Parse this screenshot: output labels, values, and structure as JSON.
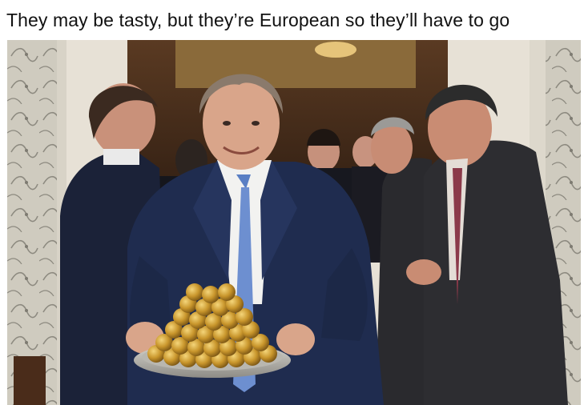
{
  "caption": {
    "text": "They may be tasty, but they’re European so they’ll have to go"
  },
  "photo": {
    "subject": "man-in-blue-suit-holding-tray-of-gold-foil-chocolates",
    "colors": {
      "wallpaper": "#c9c5b8",
      "suit_blue": "#1f2c4f",
      "suit_grey": "#2f2f33",
      "gold": "#d9ab3c",
      "skin": "#d9a58a",
      "shirt": "#f2f2f0"
    }
  }
}
